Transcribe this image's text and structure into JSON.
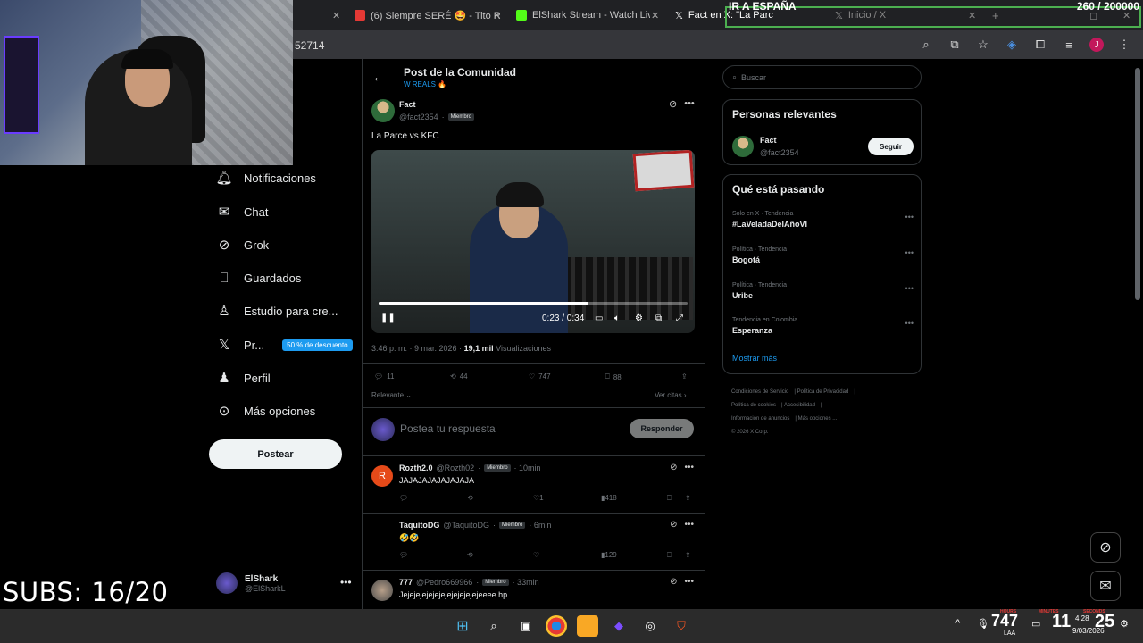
{
  "browser": {
    "tabs": [
      {
        "title": "(6) Siempre SERÉ 🤩 - Tito R",
        "icon_color": "#e53935"
      },
      {
        "title": "ElShark Stream - Watch Live",
        "icon_color": "#53fc18"
      },
      {
        "title": "Fact en X: \"La Parce vs K",
        "icon_color": "#ffffff"
      },
      {
        "title": "Inicio / X",
        "icon_color": "#ffffff"
      }
    ],
    "url_fragment": "52714",
    "profile_initial": "J"
  },
  "stream_overlay": {
    "banner": "IR A ESPAÑA",
    "goal_counter": "260 / 200000",
    "subs": "SUBS: 16/20"
  },
  "nav": {
    "items": [
      {
        "label": "Notificaciones",
        "icon": "bell-icon"
      },
      {
        "label": "Chat",
        "icon": "mail-icon"
      },
      {
        "label": "Grok",
        "icon": "grok-icon"
      },
      {
        "label": "Guardados",
        "icon": "bookmark-icon"
      },
      {
        "label": "Estudio para cre...",
        "icon": "studio-icon"
      },
      {
        "label": "Pr...",
        "icon": "x-icon"
      },
      {
        "label": "Perfil",
        "icon": "person-icon"
      },
      {
        "label": "Más opciones",
        "icon": "more-circle-icon"
      }
    ],
    "premium_badge": "50 % de descuento",
    "post_button": "Postear",
    "account": {
      "name": "ElShark",
      "handle": "@ElSharkL"
    }
  },
  "post": {
    "header_title": "Post de la Comunidad",
    "community": "W REALS 🔥",
    "author_name": "Fact",
    "author_handle": "@fact2354",
    "member_badge": "Miembro",
    "text": "La Parce vs KFC",
    "video_time": "0:23 / 0:34",
    "video_progress": 0.68,
    "timestamp": "3:46 p. m. · 9 mar. 2026 ·",
    "views_count": "19,1 mil",
    "views_label": "Visualizaciones",
    "stats": {
      "replies": "11",
      "reposts": "44",
      "likes": "747",
      "bookmarks": "88"
    },
    "sort_label": "Relevante",
    "quotes_label": "Ver citas",
    "reply_placeholder": "Postea tu respuesta",
    "reply_button": "Responder"
  },
  "comments": [
    {
      "avatar": "R",
      "avatar_color": "#e64a19",
      "name": "Rozth2.0",
      "handle": "@Rozth02",
      "badge": "Miembro",
      "time": "· 10min",
      "text": "JAJAJAJAJAJAJAJA",
      "likes": "1",
      "views": "418"
    },
    {
      "avatar": "",
      "avatar_color": "#000000",
      "name": "TaquitoDG",
      "handle": "@TaquitoDG",
      "badge": "Miembro",
      "time": "· 6min",
      "text": "🤣🤣",
      "likes": "",
      "views": "129"
    },
    {
      "avatar": "",
      "avatar_color": "#5d5d5d",
      "name": "777",
      "handle": "@Pedro669966",
      "badge": "Miembro",
      "time": "· 33min",
      "text": "Jejejejejejejejejejejejejeeee hp",
      "likes": "",
      "views": ""
    }
  ],
  "sidebar": {
    "search_placeholder": "Buscar",
    "relevant_title": "Personas relevantes",
    "relevant_user": {
      "name": "Fact",
      "handle": "@fact2354",
      "button": "Seguir"
    },
    "trends_title": "Qué está pasando",
    "trends": [
      {
        "context": "Solo en X · Tendencia",
        "name": "#LaVeladaDelAñoVI"
      },
      {
        "context": "Política · Tendencia",
        "name": "Bogotá"
      },
      {
        "context": "Política · Tendencia",
        "name": "Uribe"
      },
      {
        "context": "Tendencia en Colombia",
        "name": "Esperanza"
      }
    ],
    "show_more": "Mostrar más",
    "footer_links": [
      "Condiciones de Servicio",
      "Política de Privacidad",
      "Política de cookies",
      "Accesibilidad",
      "Información de anuncios",
      "Más opciones ...",
      "© 2026 X Corp."
    ]
  },
  "taskbar": {
    "tray_number": "747",
    "clock_hours_label": "HOURS",
    "clock_minutes_label": "MINUTES",
    "clock_seconds_label": "SECONDS",
    "clock_minutes": "11",
    "clock_seconds": "25",
    "time": "4:28",
    "date": "9/03/2026",
    "lang": "LAA"
  }
}
